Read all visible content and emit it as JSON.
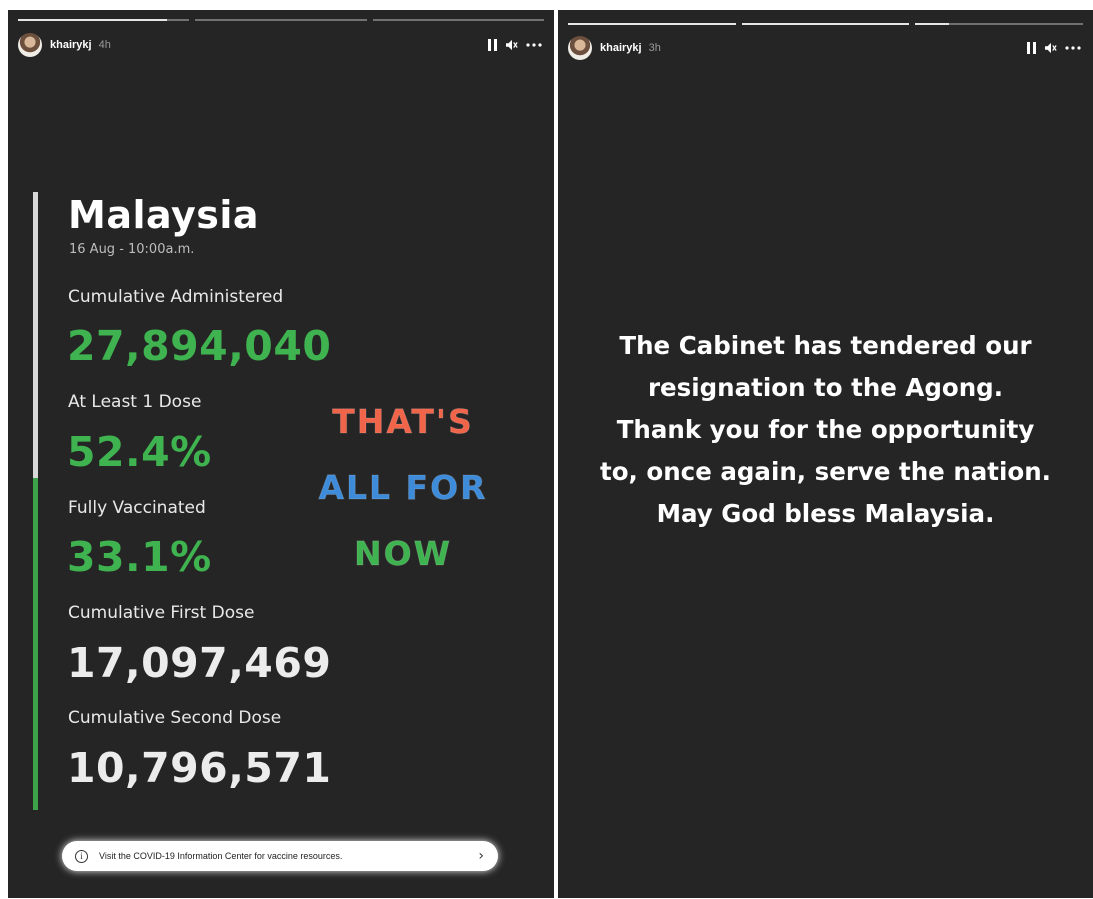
{
  "story_left": {
    "progress": [
      0.87,
      0,
      0
    ],
    "header": {
      "username": "khairykj",
      "time_ago": "4h"
    },
    "country": "Malaysia",
    "date": "16 Aug - 10:00a.m.",
    "stats": [
      {
        "label": "Cumulative Administered",
        "value": "27,894,040",
        "color": "green"
      },
      {
        "label": "At Least 1 Dose",
        "value": "52.4%",
        "color": "green"
      },
      {
        "label": "Fully Vaccinated",
        "value": "33.1%",
        "color": "green"
      },
      {
        "label": "Cumulative First Dose",
        "value": "17,097,469",
        "color": "white"
      },
      {
        "label": "Cumulative Second Dose",
        "value": "10,796,571",
        "color": "white"
      }
    ],
    "sticker": {
      "line1": "THAT'S",
      "line2": "ALL FOR",
      "line3": "NOW",
      "colors": [
        "#f0644a",
        "#3d8bd9",
        "#3fb34f"
      ]
    },
    "info_banner": "Visit the COVID-19 Information Center for vaccine resources."
  },
  "story_right": {
    "progress": [
      1,
      1,
      0.2
    ],
    "header": {
      "username": "khairykj",
      "time_ago": "3h"
    },
    "message_lines": [
      "The Cabinet has tendered our",
      "resignation to the Agong.",
      "Thank you for the opportunity",
      "to, once again, serve the nation.",
      "May God bless Malaysia."
    ]
  },
  "icons": {
    "pause": "pause-icon",
    "mute": "mute-icon",
    "more": "more-icon",
    "info": "info-icon",
    "chevron": "chevron-right-icon"
  },
  "colors": {
    "story_bg": "#252525",
    "green": "#3fb34f",
    "gray_bar": "#d8d8d8"
  }
}
